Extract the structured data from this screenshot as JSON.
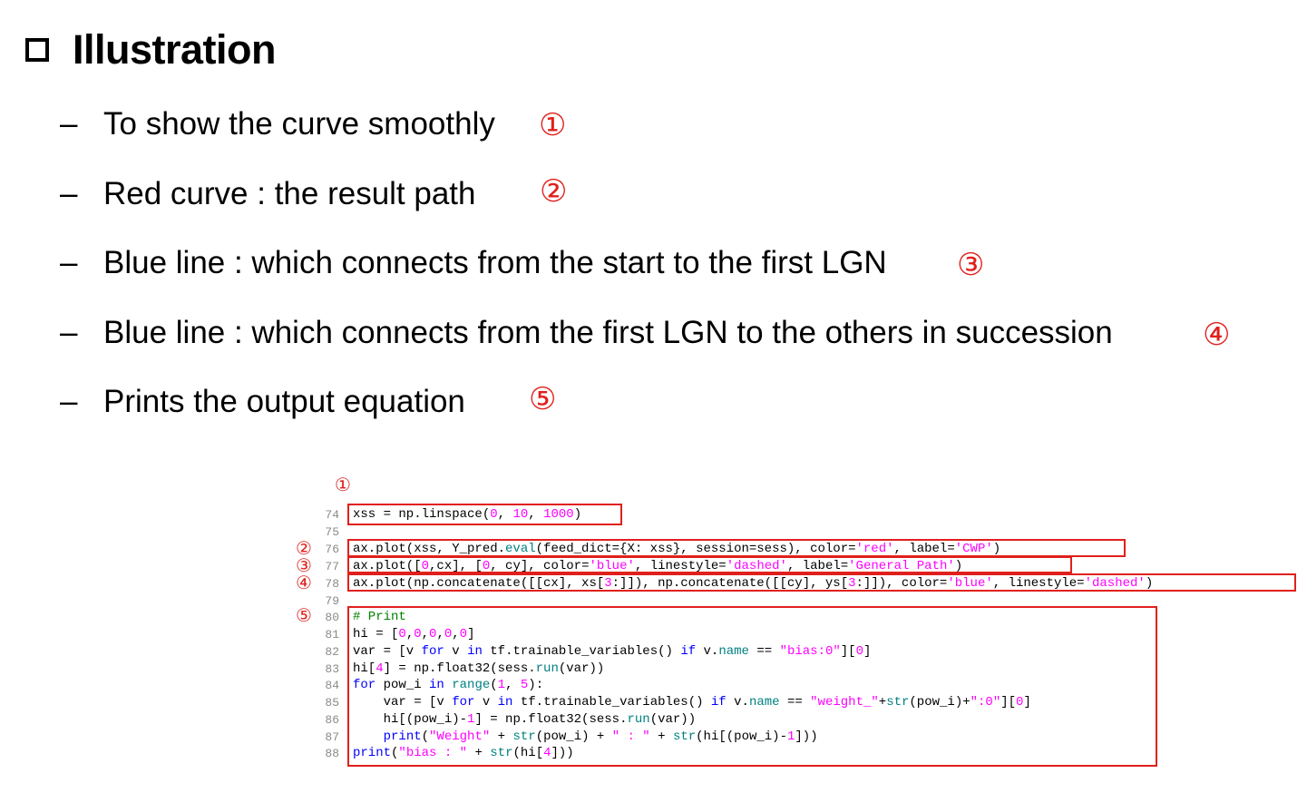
{
  "title": "Illustration",
  "bullets": [
    {
      "text": "To show the curve smoothly",
      "marker": "①"
    },
    {
      "text": "Red curve : the result path",
      "marker": "②"
    },
    {
      "text": "Blue line : which connects from the start to the first LGN",
      "marker": "③"
    },
    {
      "text": "Blue line : which connects from the first LGN to the others in succession",
      "marker": "④"
    },
    {
      "text": "Prints the output equation",
      "marker": "⑤"
    }
  ],
  "dash": "–",
  "code_markers": [
    "①",
    "②",
    "③",
    "④",
    "⑤"
  ],
  "code": {
    "line_numbers": [
      "74",
      "75",
      "76",
      "77",
      "78",
      "79",
      "80",
      "81",
      "82",
      "83",
      "84",
      "85",
      "86",
      "87",
      "88"
    ],
    "lines": [
      [
        [
          "t",
          "xss = np.linspace("
        ],
        [
          "n",
          "0"
        ],
        [
          "t",
          ", "
        ],
        [
          "n",
          "10"
        ],
        [
          "t",
          ", "
        ],
        [
          "n",
          "1000"
        ],
        [
          "t",
          ")"
        ]
      ],
      [],
      [
        [
          "t",
          "ax.plot(xss, Y_pred."
        ],
        [
          "f",
          "eval"
        ],
        [
          "t",
          "(feed_dict={X: xss}, session=sess), color="
        ],
        [
          "s",
          "'red'"
        ],
        [
          "t",
          ", label="
        ],
        [
          "s",
          "'CWP'"
        ],
        [
          "t",
          ")"
        ]
      ],
      [
        [
          "t",
          "ax.plot(["
        ],
        [
          "n",
          "0"
        ],
        [
          "t",
          ",cx], ["
        ],
        [
          "n",
          "0"
        ],
        [
          "t",
          ", cy], color="
        ],
        [
          "s",
          "'blue'"
        ],
        [
          "t",
          ", linestyle="
        ],
        [
          "s",
          "'dashed'"
        ],
        [
          "t",
          ", label="
        ],
        [
          "s",
          "'General Path'"
        ],
        [
          "t",
          ")"
        ]
      ],
      [
        [
          "t",
          "ax.plot(np.concatenate([[cx], xs["
        ],
        [
          "n",
          "3"
        ],
        [
          "t",
          ":]]), np.concatenate([[cy], ys["
        ],
        [
          "n",
          "3"
        ],
        [
          "t",
          ":]]), color="
        ],
        [
          "s",
          "'blue'"
        ],
        [
          "t",
          ", linestyle="
        ],
        [
          "s",
          "'dashed'"
        ],
        [
          "t",
          ")"
        ]
      ],
      [],
      [
        [
          "c",
          "# Print"
        ]
      ],
      [
        [
          "t",
          "hi = ["
        ],
        [
          "n",
          "0"
        ],
        [
          "t",
          ","
        ],
        [
          "n",
          "0"
        ],
        [
          "t",
          ","
        ],
        [
          "n",
          "0"
        ],
        [
          "t",
          ","
        ],
        [
          "n",
          "0"
        ],
        [
          "t",
          ","
        ],
        [
          "n",
          "0"
        ],
        [
          "t",
          "]"
        ]
      ],
      [
        [
          "t",
          "var = [v "
        ],
        [
          "k",
          "for"
        ],
        [
          "t",
          " v "
        ],
        [
          "k",
          "in"
        ],
        [
          "t",
          " tf.trainable_variables() "
        ],
        [
          "k",
          "if"
        ],
        [
          "t",
          " v."
        ],
        [
          "f",
          "name"
        ],
        [
          "t",
          " == "
        ],
        [
          "s",
          "\"bias:0\""
        ],
        [
          "t",
          "]["
        ],
        [
          "n",
          "0"
        ],
        [
          "t",
          "]"
        ]
      ],
      [
        [
          "t",
          "hi["
        ],
        [
          "n",
          "4"
        ],
        [
          "t",
          "] = np.float32(sess."
        ],
        [
          "f",
          "run"
        ],
        [
          "t",
          "(var))"
        ]
      ],
      [
        [
          "k",
          "for"
        ],
        [
          "t",
          " pow_i "
        ],
        [
          "k",
          "in"
        ],
        [
          "t",
          " "
        ],
        [
          "f",
          "range"
        ],
        [
          "t",
          "("
        ],
        [
          "n",
          "1"
        ],
        [
          "t",
          ", "
        ],
        [
          "n",
          "5"
        ],
        [
          "t",
          "):"
        ]
      ],
      [
        [
          "t",
          "    var = [v "
        ],
        [
          "k",
          "for"
        ],
        [
          "t",
          " v "
        ],
        [
          "k",
          "in"
        ],
        [
          "t",
          " tf.trainable_variables() "
        ],
        [
          "k",
          "if"
        ],
        [
          "t",
          " v."
        ],
        [
          "f",
          "name"
        ],
        [
          "t",
          " == "
        ],
        [
          "s",
          "\"weight_\""
        ],
        [
          "t",
          "+"
        ],
        [
          "f",
          "str"
        ],
        [
          "t",
          "(pow_i)+"
        ],
        [
          "s",
          "\":0\""
        ],
        [
          "t",
          "]["
        ],
        [
          "n",
          "0"
        ],
        [
          "t",
          "]"
        ]
      ],
      [
        [
          "t",
          "    hi[(pow_i)-"
        ],
        [
          "n",
          "1"
        ],
        [
          "t",
          "] = np.float32(sess."
        ],
        [
          "f",
          "run"
        ],
        [
          "t",
          "(var))"
        ]
      ],
      [
        [
          "t",
          "    "
        ],
        [
          "k",
          "print"
        ],
        [
          "t",
          "("
        ],
        [
          "s",
          "\"Weight\""
        ],
        [
          "t",
          " + "
        ],
        [
          "f",
          "str"
        ],
        [
          "t",
          "(pow_i) + "
        ],
        [
          "s",
          "\" : \""
        ],
        [
          "t",
          " + "
        ],
        [
          "f",
          "str"
        ],
        [
          "t",
          "(hi[(pow_i)-"
        ],
        [
          "n",
          "1"
        ],
        [
          "t",
          "]))"
        ]
      ],
      [
        [
          "k",
          "print"
        ],
        [
          "t",
          "("
        ],
        [
          "s",
          "\"bias : \""
        ],
        [
          "t",
          " + "
        ],
        [
          "f",
          "str"
        ],
        [
          "t",
          "(hi["
        ],
        [
          "n",
          "4"
        ],
        [
          "t",
          "]))"
        ]
      ]
    ]
  }
}
